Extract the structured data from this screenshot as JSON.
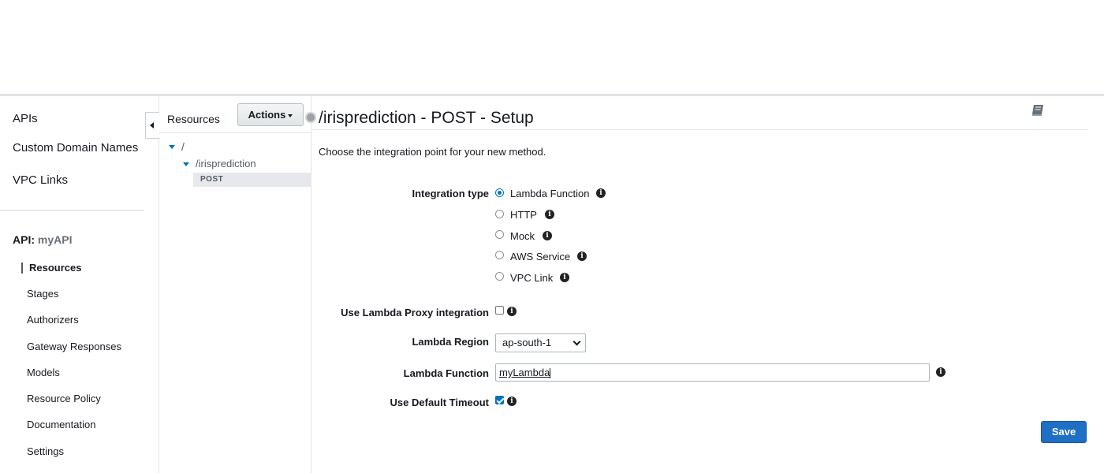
{
  "nav": {
    "top_items": [
      {
        "label": "APIs"
      },
      {
        "label": "Custom Domain Names"
      },
      {
        "label": "VPC Links"
      }
    ],
    "api_prefix": "API:",
    "api_name": "myAPI",
    "sub_items": [
      {
        "label": "Resources",
        "active": true
      },
      {
        "label": "Stages"
      },
      {
        "label": "Authorizers"
      },
      {
        "label": "Gateway Responses"
      },
      {
        "label": "Models"
      },
      {
        "label": "Resource Policy"
      },
      {
        "label": "Documentation"
      },
      {
        "label": "Settings"
      }
    ]
  },
  "resources": {
    "label": "Resources",
    "actions_label": "Actions",
    "tree": {
      "root": "/",
      "child": "/irisprediction",
      "method": "POST"
    }
  },
  "main": {
    "title": "/irisprediction - POST - Setup",
    "intro": "Choose the integration point for your new method.",
    "integration_type_label": "Integration type",
    "integration_options": [
      {
        "label": "Lambda Function",
        "selected": true
      },
      {
        "label": "HTTP",
        "selected": false
      },
      {
        "label": "Mock",
        "selected": false
      },
      {
        "label": "AWS Service",
        "selected": false
      },
      {
        "label": "VPC Link",
        "selected": false
      }
    ],
    "proxy_label": "Use Lambda Proxy integration",
    "proxy_checked": false,
    "region_label": "Lambda Region",
    "region_value": "ap-south-1",
    "function_label": "Lambda Function",
    "function_value": "myLambda",
    "timeout_label": "Use Default Timeout",
    "timeout_checked": true,
    "save_label": "Save"
  },
  "colors": {
    "accent": "#0073bb",
    "save_button": "#1f6fc5"
  }
}
